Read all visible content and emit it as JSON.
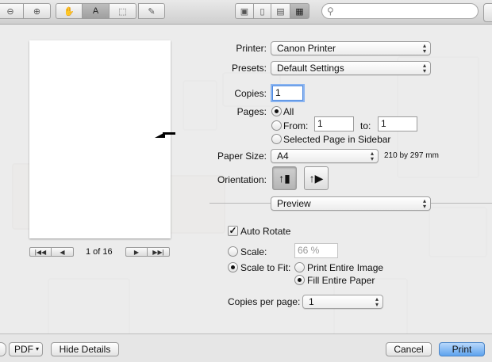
{
  "toolbar": {
    "search_placeholder": ""
  },
  "preview": {
    "page_indicator": "1 of 16"
  },
  "form": {
    "printer_label": "Printer:",
    "printer_value": "Canon Printer",
    "presets_label": "Presets:",
    "presets_value": "Default Settings",
    "copies_label": "Copies:",
    "copies_value": "1",
    "pages_label": "Pages:",
    "pages_all": "All",
    "pages_from": "From:",
    "from_value": "1",
    "pages_to": "to:",
    "to_value": "1",
    "pages_selected": "Selected Page in Sidebar",
    "paper_size_label": "Paper Size:",
    "paper_size_value": "A4",
    "paper_size_dims": "210 by 297 mm",
    "orientation_label": "Orientation:",
    "section_value": "Preview",
    "auto_rotate": "Auto Rotate",
    "scale_label": "Scale:",
    "scale_value": "66 %",
    "scale_to_fit": "Scale to Fit:",
    "print_entire": "Print Entire Image",
    "fill_entire": "Fill Entire Paper",
    "copies_per_page_label": "Copies per page:",
    "copies_per_page_value": "1"
  },
  "bottom": {
    "pdf_label": "PDF",
    "hide_details": "Hide Details",
    "cancel": "Cancel",
    "print": "Print"
  },
  "colors": {
    "primary_button": "#5ea3ee",
    "focus_ring": "#8ab4f0"
  },
  "icons": [
    "zoom-out-icon",
    "zoom-in-icon",
    "hand-icon",
    "text-select-icon",
    "rect-select-icon",
    "pen-icon",
    "view-mode-icon",
    "search-icon",
    "first-page-icon",
    "prev-page-icon",
    "next-page-icon",
    "last-page-icon",
    "portrait-icon",
    "landscape-icon",
    "help-icon"
  ]
}
